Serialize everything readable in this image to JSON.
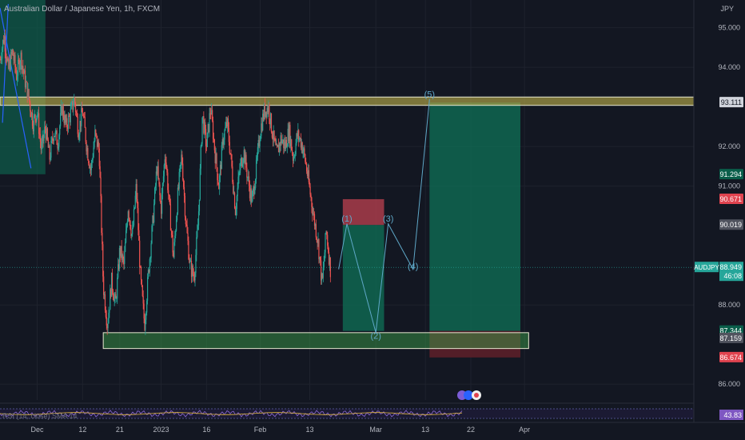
{
  "header": {
    "title": "Australian Dollar / Japanese Yen, 1h, FXCM",
    "currency": "JPY"
  },
  "rsi_label": "RSI (14, close) SMA 14",
  "chart_data": {
    "type": "candlestick",
    "symbol": "AUDJPY",
    "ylim": [
      85.6,
      95.7
    ],
    "x_domain": [
      0,
      168
    ],
    "y_ticks": [
      {
        "value": 95.0,
        "label": "95.000"
      },
      {
        "value": 94.0,
        "label": "94.000"
      },
      {
        "value": 92.0,
        "label": "92.000"
      },
      {
        "value": 91.0,
        "label": "91.000"
      },
      {
        "value": 88.0,
        "label": "88.000"
      },
      {
        "value": 86.0,
        "label": "86.000"
      }
    ],
    "x_ticks": [
      {
        "day": 9,
        "label": "Dec"
      },
      {
        "day": 20,
        "label": "12"
      },
      {
        "day": 29,
        "label": "21"
      },
      {
        "day": 39,
        "label": "2023"
      },
      {
        "day": 50,
        "label": "16"
      },
      {
        "day": 63,
        "label": "Feb"
      },
      {
        "day": 75,
        "label": "13"
      },
      {
        "day": 91,
        "label": "Mar"
      },
      {
        "day": 103,
        "label": "13"
      },
      {
        "day": 114,
        "label": "22"
      },
      {
        "day": 127,
        "label": "Apr"
      }
    ],
    "price_path": [
      [
        0,
        94.2
      ],
      [
        1,
        94.8
      ],
      [
        2,
        93.9
      ],
      [
        3,
        94.4
      ],
      [
        4,
        93.8
      ],
      [
        5,
        94.3
      ],
      [
        6,
        93.7
      ],
      [
        7,
        93.2
      ],
      [
        8,
        92.6
      ],
      [
        9,
        92.9
      ],
      [
        10,
        91.9
      ],
      [
        11,
        92.5
      ],
      [
        12,
        91.7
      ],
      [
        13,
        92.4
      ],
      [
        14,
        92.1
      ],
      [
        15,
        93.0
      ],
      [
        16,
        92.5
      ],
      [
        17,
        92.8
      ],
      [
        18,
        93.2
      ],
      [
        19,
        92.4
      ],
      [
        20,
        92.9
      ],
      [
        21,
        92.0
      ],
      [
        22,
        91.4
      ],
      [
        23,
        92.3
      ],
      [
        24,
        91.9
      ],
      [
        25,
        88.5
      ],
      [
        26,
        87.5
      ],
      [
        27,
        88.6
      ],
      [
        28,
        88.0
      ],
      [
        29,
        89.4
      ],
      [
        30,
        89.0
      ],
      [
        31,
        90.5
      ],
      [
        32,
        89.7
      ],
      [
        33,
        91.0
      ],
      [
        34,
        88.7
      ],
      [
        35,
        87.5
      ],
      [
        36,
        88.9
      ],
      [
        37,
        90.1
      ],
      [
        38,
        91.5
      ],
      [
        39,
        90.4
      ],
      [
        40,
        91.9
      ],
      [
        41,
        90.5
      ],
      [
        42,
        89.2
      ],
      [
        43,
        90.7
      ],
      [
        44,
        91.8
      ],
      [
        45,
        90.1
      ],
      [
        46,
        89.0
      ],
      [
        47,
        88.7
      ],
      [
        48,
        90.1
      ],
      [
        49,
        92.8
      ],
      [
        50,
        92.0
      ],
      [
        51,
        93.0
      ],
      [
        52,
        91.9
      ],
      [
        53,
        91.0
      ],
      [
        54,
        92.2
      ],
      [
        55,
        92.6
      ],
      [
        56,
        91.6
      ],
      [
        57,
        90.4
      ],
      [
        58,
        91.4
      ],
      [
        59,
        91.9
      ],
      [
        60,
        91.2
      ],
      [
        61,
        90.6
      ],
      [
        62,
        91.4
      ],
      [
        63,
        92.4
      ],
      [
        64,
        92.9
      ],
      [
        65,
        93.0
      ],
      [
        66,
        92.3
      ],
      [
        67,
        91.8
      ],
      [
        68,
        92.2
      ],
      [
        69,
        92.0
      ],
      [
        70,
        92.4
      ],
      [
        71,
        91.7
      ],
      [
        72,
        92.3
      ],
      [
        73,
        92.1
      ],
      [
        74,
        91.6
      ],
      [
        75,
        90.9
      ],
      [
        76,
        90.2
      ],
      [
        77,
        89.6
      ],
      [
        78,
        88.5
      ],
      [
        79,
        89.9
      ],
      [
        80,
        88.9
      ]
    ],
    "candle_count": 460,
    "rsi_value": "43.83",
    "horizontal_zones": [
      {
        "name": "resistance",
        "from": 93.04,
        "to": 93.25,
        "color": "#b5a84a"
      },
      {
        "name": "support",
        "from": 86.9,
        "to": 87.3,
        "color": "#3fa74b"
      }
    ],
    "positions": [
      {
        "name": "long-position",
        "x_from": 104,
        "x_to": 126,
        "entry": 87.344,
        "target": 93.111,
        "stop": 86.674
      },
      {
        "name": "short-position",
        "x_from": 83,
        "x_to": 93,
        "entry": 90.019,
        "stop": 90.671,
        "target": 87.344
      }
    ],
    "early_box": {
      "x_from": 0,
      "x_to": 11,
      "top": 95.7,
      "bottom": 91.3
    },
    "elliott_waves": [
      {
        "label": "(1)",
        "day": 84,
        "price": 90.1
      },
      {
        "label": "(2)",
        "day": 91,
        "price": 87.15
      },
      {
        "label": "(3)",
        "day": 94,
        "price": 90.1
      },
      {
        "label": "(4)",
        "day": 100,
        "price": 88.9
      },
      {
        "label": "(5)",
        "day": 104,
        "price": 93.25
      }
    ],
    "wave_path": [
      [
        82,
        88.9
      ],
      [
        84,
        90.05
      ],
      [
        91,
        87.3
      ],
      [
        94,
        90.05
      ],
      [
        100,
        88.9
      ],
      [
        104,
        93.2
      ]
    ],
    "price_labels": [
      {
        "text": "93.111",
        "price": 93.111,
        "bg": "#d1d4dc",
        "fg": "#131722"
      },
      {
        "text": "91.294",
        "price": 91.294,
        "bg": "#0a5e4a",
        "fg": "#ffffff"
      },
      {
        "text": "90.671",
        "price": 90.671,
        "bg": "#e0434f",
        "fg": "#ffffff"
      },
      {
        "text": "90.019",
        "price": 90.019,
        "bg": "#50535e",
        "fg": "#ffffff"
      },
      {
        "text": "87.344",
        "price": 87.344,
        "bg": "#0a5e4a",
        "fg": "#ffffff"
      },
      {
        "text": "87.159",
        "price": 87.159,
        "bg": "#50535e",
        "fg": "#ffffff"
      },
      {
        "text": "86.674",
        "price": 86.674,
        "bg": "#e0434f",
        "fg": "#ffffff"
      }
    ],
    "last_price": {
      "symbol": "AUDJPY",
      "price": "88.949",
      "countdown": "46:08",
      "value": 88.949
    }
  }
}
